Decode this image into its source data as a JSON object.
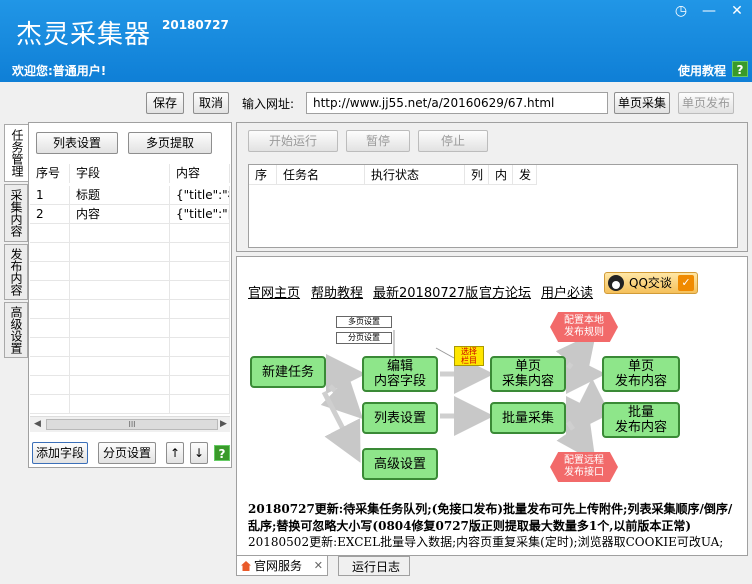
{
  "window": {
    "title": "杰灵采集器",
    "version": "20180727",
    "welcome": "欢迎您:普通用户!",
    "tutorial_label": "使用教程",
    "help_glyph": "?",
    "controls": {
      "clock": "◷",
      "minimize": "—",
      "close": "✕"
    }
  },
  "toolbar": {
    "save_label": "保存",
    "cancel_label": "取消",
    "url_label": "输入网址:",
    "url_value": "http://www.jj55.net/a/20160629/67.html",
    "single_collect_label": "单页采集",
    "single_publish_label": "单页发布"
  },
  "left_tabs": [
    "任务管理",
    "采集内容",
    "发布内容",
    "高级设置"
  ],
  "left_panel": {
    "list_settings_label": "列表设置",
    "multi_page_label": "多页提取",
    "columns": [
      "序号",
      "字段",
      "内容"
    ],
    "rows": [
      {
        "no": "1",
        "field": "标题",
        "content": "{\"title\":\"标题"
      },
      {
        "no": "2",
        "field": "内容",
        "content": "{\"title\":\"内容"
      }
    ],
    "scroll_thumb": "III",
    "add_field_label": "添加字段",
    "page_settings_label": "分页设置",
    "up_glyph": "↑",
    "down_glyph": "↓"
  },
  "task": {
    "start_label": "开始运行",
    "pause_label": "暂停",
    "stop_label": "停止",
    "columns": [
      "序",
      "任务名",
      "执行状态",
      "列",
      "内",
      "发"
    ]
  },
  "service": {
    "links": [
      "官网主页",
      "帮助教程",
      "最新20180727版",
      "官方论坛",
      "用户必读"
    ],
    "qq_label": "QQ交谈",
    "qq_check": "✓",
    "diagram": {
      "new_task": "新建任务",
      "edit_fields": [
        "编辑",
        "内容字段"
      ],
      "list_settings": "列表设置",
      "advanced_settings": "高级设置",
      "single_collect": [
        "单页",
        "采集内容"
      ],
      "batch_collect": "批量采集",
      "single_publish": [
        "单页",
        "发布内容"
      ],
      "batch_publish": [
        "批量",
        "发布内容"
      ],
      "local_rules": [
        "配置本地",
        "发布规则"
      ],
      "remote_rules": [
        "配置远程",
        "发布接口"
      ],
      "multi_page_small": "多页设置",
      "paging_small": "分页设置",
      "select_tag": [
        "选择",
        "栏目"
      ]
    },
    "news_bold": "20180727更新:待采集任务队列;(免接口发布)批量发布可先上传附件;列表采集顺序/倒序/乱序;替换可忽略大小写(0804修复0727版正则提取最大数量多1个,以前版本正常)",
    "news_plain": "20180502更新:EXCEL批量导入数据;内容页重复采集(定时);浏览器取COOKIE可改UA;"
  },
  "bottom_tabs": {
    "service_label": "官网服务",
    "close_glyph": "✕",
    "log_label": "运行日志"
  }
}
